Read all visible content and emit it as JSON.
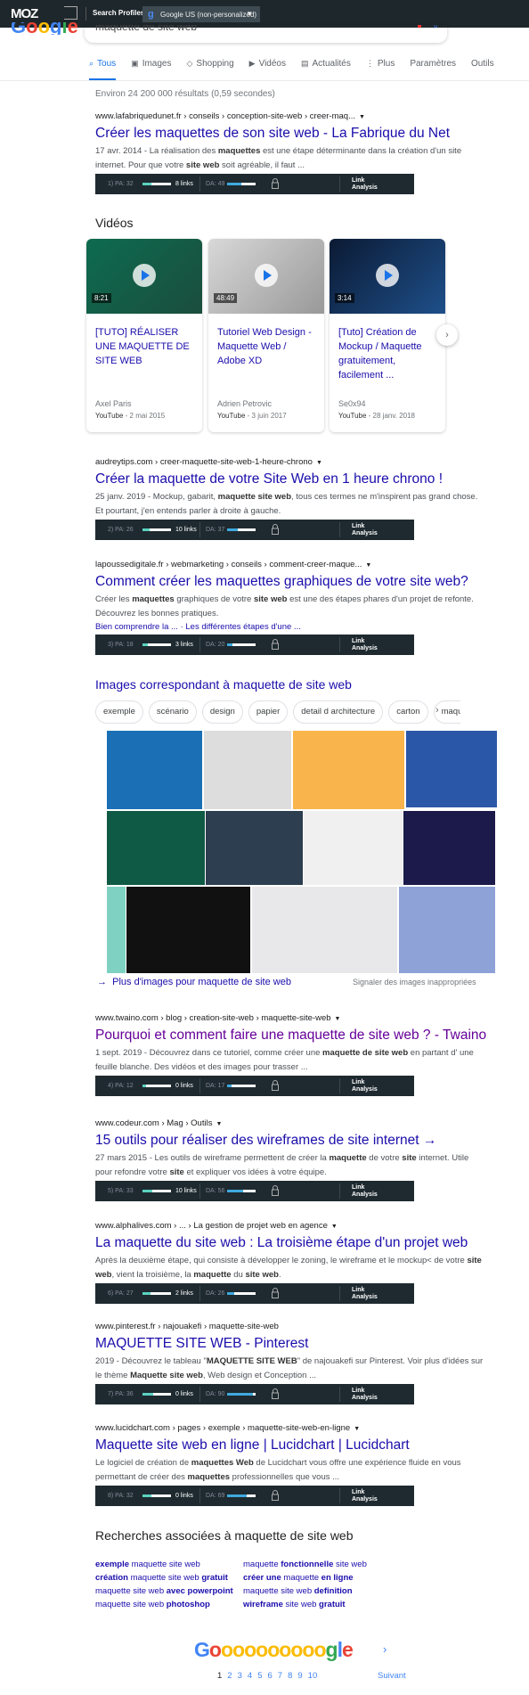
{
  "moz": {
    "logo": "MOZ",
    "search_profiles": "Search Profiles",
    "profile": "Google US (non-personalized)"
  },
  "google": {
    "logo": "Google",
    "query": "maquette de site web"
  },
  "tabs": [
    {
      "label": "Tous",
      "icon": "search-icon",
      "active": true
    },
    {
      "label": "Images",
      "icon": "image-icon"
    },
    {
      "label": "Shopping",
      "icon": "tag-icon"
    },
    {
      "label": "Vidéos",
      "icon": "play-icon"
    },
    {
      "label": "Actualités",
      "icon": "news-icon"
    },
    {
      "label": "Plus",
      "icon": "more-vert-icon"
    },
    {
      "label": "Paramètres"
    },
    {
      "label": "Outils"
    }
  ],
  "result_count": "Environ 24 200 000 résultats (0,59 secondes)",
  "colors": {
    "link": "#1a0dab",
    "visited": "#660099",
    "moz_bg": "#1e2a30",
    "pa_fill": "#5bd2c0",
    "da_fill": "#3fa9de",
    "accent": "#1a73e8"
  },
  "results": [
    {
      "url": "www.lafabriquedunet.fr › conseils › conception-site-web › creer-maq...",
      "dropdown": true,
      "title": "Créer les maquettes de son site web - La Fabrique du Net",
      "snippet": [
        [
          "17 avr. 2014 - La réalisation des ",
          0
        ],
        [
          "maquettes",
          1
        ],
        [
          " est une étape déterminante dans la création d'un site internet. Pour que votre ",
          0
        ],
        [
          "site web",
          1
        ],
        [
          " soit agréable, il faut ...",
          0
        ]
      ],
      "moz": {
        "rank": "1)",
        "pa": 32,
        "links": "8 links",
        "da": 49
      }
    },
    {
      "url": "audreytips.com › creer-maquette-site-web-1-heure-chrono",
      "dropdown": true,
      "title": "Créer la maquette de votre Site Web en 1 heure chrono !",
      "snippet": [
        [
          "25 janv. 2019 - Mockup, gabarit, ",
          0
        ],
        [
          "maquette site web",
          1
        ],
        [
          ", tous ces termes ne m'inspirent pas grand chose. Et pourtant, j'en entends parler à droite à gauche.",
          0
        ]
      ],
      "moz": {
        "rank": "2)",
        "pa": 26,
        "links": "10 links",
        "da": 37
      }
    },
    {
      "url": "lapoussedigitale.fr › webmarketing › conseils › comment-creer-maque...",
      "dropdown": true,
      "title": "Comment créer les maquettes graphiques de votre site web?",
      "snippet": [
        [
          "Créer les ",
          0
        ],
        [
          "maquettes",
          1
        ],
        [
          " graphiques de votre ",
          0
        ],
        [
          "site web",
          1
        ],
        [
          " est une des étapes phares d'un projet de refonte. Découvrez les bonnes pratiques.",
          0
        ]
      ],
      "sitelinks": [
        "Bien comprendre la ...",
        "Les différentes étapes d'une ..."
      ],
      "moz": {
        "rank": "3)",
        "pa": 18,
        "links": "3 links",
        "da": 20
      }
    },
    {
      "url": "www.twaino.com › blog › creation-site-web › maquette-site-web",
      "dropdown": true,
      "visited": true,
      "title": "Pourquoi et comment faire une maquette de site web ? - Twaino",
      "snippet": [
        [
          "1 sept. 2019 - Découvrez dans ce tutoriel, comme créer une ",
          0
        ],
        [
          "maquette de site web",
          1
        ],
        [
          " en partant d' une feuille blanche. Des vidéos et des images pour trasser ...",
          0
        ]
      ],
      "moz": {
        "rank": "4)",
        "pa": 12,
        "links": "0 links",
        "da": 17
      }
    },
    {
      "url": "www.codeur.com › Mag › Outils",
      "dropdown": true,
      "title": "15 outils pour réaliser des wireframes de site internet →",
      "snippet": [
        [
          "27 mars 2015 - Les outils de wireframe permettent de créer la ",
          0
        ],
        [
          "maquette",
          1
        ],
        [
          " de votre ",
          0
        ],
        [
          "site",
          1
        ],
        [
          " internet. Utile pour refondre votre ",
          0
        ],
        [
          "site",
          1
        ],
        [
          " et expliquer vos idées à votre équipe.",
          0
        ]
      ],
      "moz": {
        "rank": "5)",
        "pa": 33,
        "links": "10 links",
        "da": 56
      }
    },
    {
      "url": "www.alphalives.com › ... › La gestion de projet web en agence",
      "dropdown": true,
      "title": "La maquette du site web : La troisième étape d'un projet web",
      "snippet": [
        [
          "Après la deuxième étape, qui consiste à développer le zoning, le wireframe et le mockup< de votre ",
          0
        ],
        [
          "site web",
          1
        ],
        [
          ", vient la troisième, la ",
          0
        ],
        [
          "maquette",
          1
        ],
        [
          " du ",
          0
        ],
        [
          "site web",
          1
        ],
        [
          ".",
          0
        ]
      ],
      "moz": {
        "rank": "6)",
        "pa": 27,
        "links": "2 links",
        "da": 26
      }
    },
    {
      "url": "www.pinterest.fr › najouakefi › maquette-site-web",
      "dropdown": false,
      "title": "MAQUETTE SITE WEB - Pinterest",
      "snippet": [
        [
          "2019 - Découvrez le tableau \"",
          0
        ],
        [
          "MAQUETTE SITE WEB",
          1
        ],
        [
          "\" de najouakefi sur Pinterest. Voir plus d'idées sur le thème ",
          0
        ],
        [
          "Maquette site web",
          1
        ],
        [
          ", Web design et Conception ...",
          0
        ]
      ],
      "moz": {
        "rank": "7)",
        "pa": 36,
        "links": "0 links",
        "da": 90
      }
    },
    {
      "url": "www.lucidchart.com › pages › exemple › maquette-site-web-en-ligne",
      "dropdown": true,
      "title": "Maquette site web en ligne | Lucidchart | Lucidchart",
      "snippet": [
        [
          "Le logiciel de création de ",
          0
        ],
        [
          "maquettes Web",
          1
        ],
        [
          " de Lucidchart vous offre une expérience fluide en vous permettant de créer des ",
          0
        ],
        [
          "maquettes",
          1
        ],
        [
          " professionnelles que vous ...",
          0
        ]
      ],
      "moz": {
        "rank": "8)",
        "pa": 32,
        "links": "0 links",
        "da": 69
      }
    }
  ],
  "moz_bar": {
    "pa_label": "PA:",
    "da_label": "DA:",
    "link_analysis": "Link Analysis"
  },
  "videos": {
    "heading": "Vidéos",
    "items": [
      {
        "title": "[TUTO] RÉALISER UNE MAQUETTE DE SITE WEB",
        "duration": "8:21",
        "channel": "Axel Paris",
        "source": "YouTube",
        "date": "- 2 mai 2015"
      },
      {
        "title": "Tutoriel Web Design - Maquette Web / Adobe XD",
        "duration": "48:49",
        "channel": "Adrien Petrovic",
        "source": "YouTube",
        "date": "- 3 juin 2017"
      },
      {
        "title": "[Tuto] Création de Mockup / Maquette gratuitement, facilement ...",
        "duration": "3:14",
        "channel": "Se0x94",
        "source": "YouTube",
        "date": "- 28 janv. 2018"
      }
    ]
  },
  "images": {
    "heading": "Images correspondant à maquette de site web",
    "chips": [
      "exemple",
      "scénario",
      "design",
      "papier",
      "detail d architecture",
      "carton",
      "maquette un"
    ],
    "more": "Plus d'images pour maquette de site web",
    "report": "Signaler des images inappropriées"
  },
  "related": {
    "heading": "Recherches associées à maquette de site web",
    "items": [
      [
        [
          "exemple",
          1
        ],
        [
          " maquette site web",
          0
        ]
      ],
      [
        [
          "maquette ",
          0
        ],
        [
          "fonctionnelle",
          1
        ],
        [
          " site web",
          0
        ]
      ],
      [
        [
          "création",
          1
        ],
        [
          " maquette site web ",
          0
        ],
        [
          "gratuit",
          1
        ]
      ],
      [
        [
          "créer une",
          1
        ],
        [
          " maquette ",
          0
        ],
        [
          "en ligne",
          1
        ]
      ],
      [
        [
          "maquette site web ",
          0
        ],
        [
          "avec powerpoint",
          1
        ]
      ],
      [
        [
          "maquette site web ",
          0
        ],
        [
          "definition",
          1
        ]
      ],
      [
        [
          "maquette site web ",
          0
        ],
        [
          "photoshop",
          1
        ]
      ],
      [
        [
          "wireframe",
          1
        ],
        [
          " site web ",
          0
        ],
        [
          "gratuit",
          1
        ]
      ]
    ]
  },
  "pagination": {
    "logo": "Goooooooooogle",
    "pages": [
      "1",
      "2",
      "3",
      "4",
      "5",
      "6",
      "7",
      "8",
      "9",
      "10"
    ],
    "current": "1",
    "next": "Suivant"
  }
}
